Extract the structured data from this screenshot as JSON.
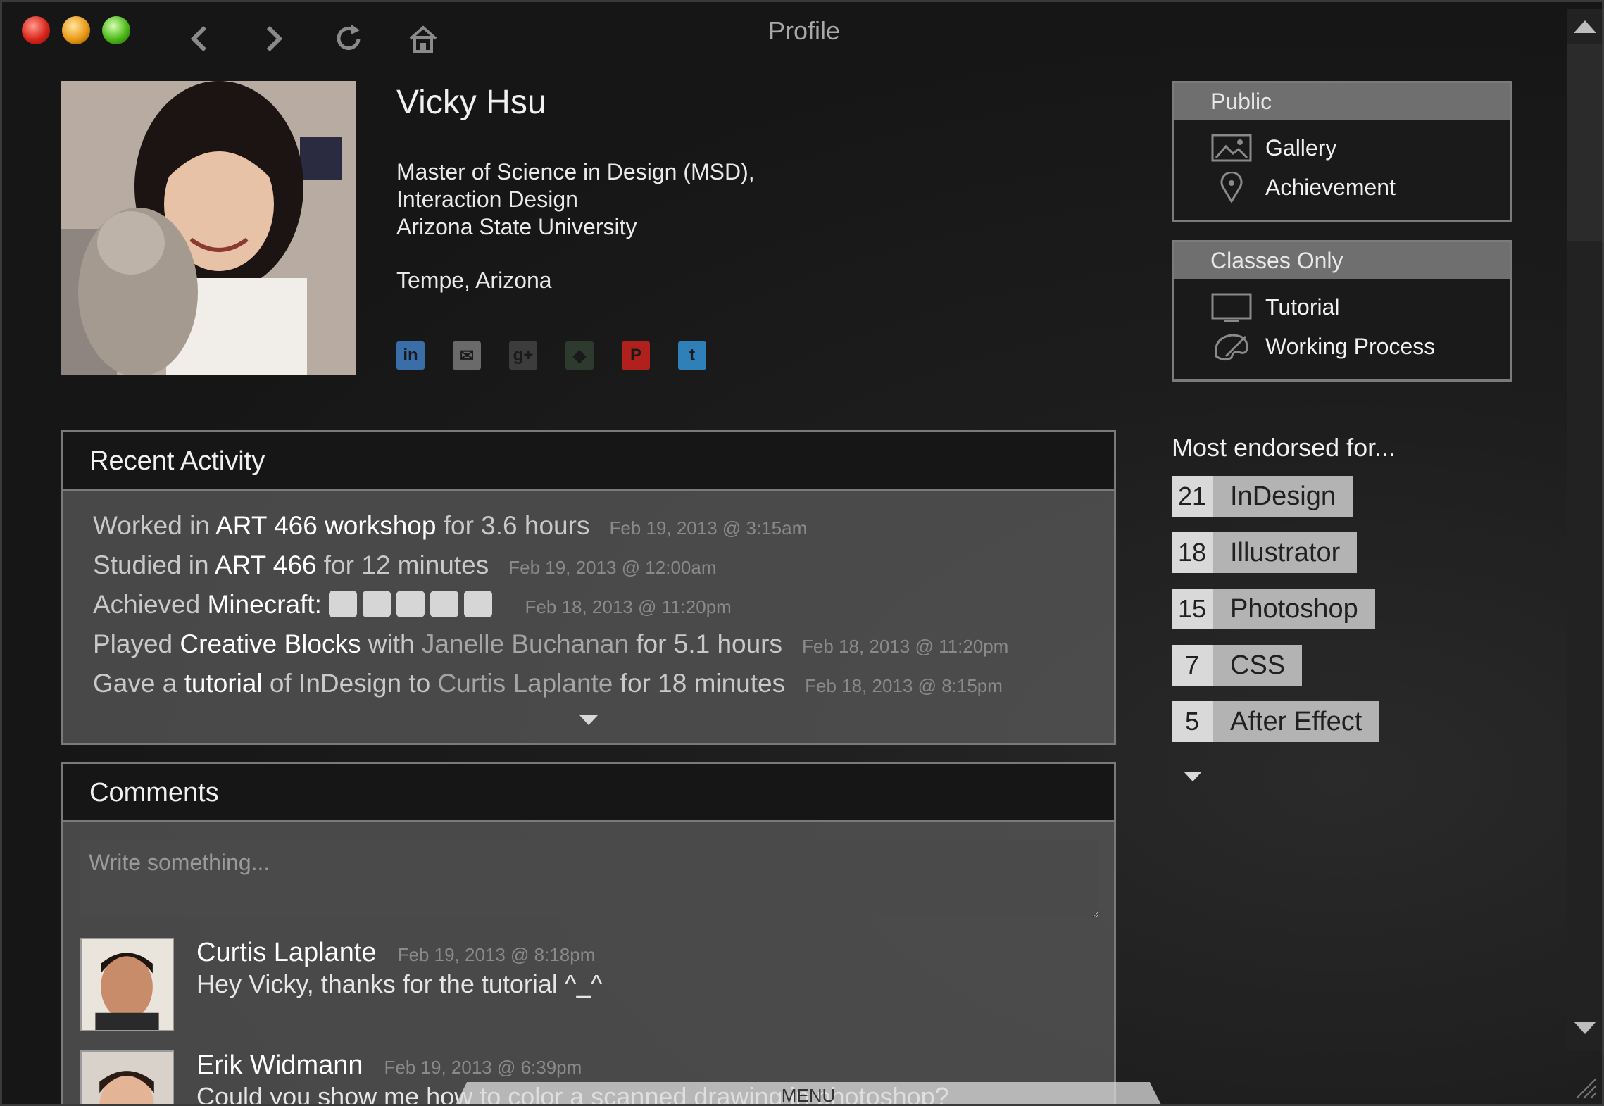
{
  "window": {
    "title": "Profile"
  },
  "toolbar": {
    "back_icon": "chevron-left-icon",
    "forward_icon": "chevron-right-icon",
    "reload_icon": "reload-icon",
    "home_icon": "home-icon"
  },
  "profile": {
    "name": "Vicky Hsu",
    "bio": [
      "Master of Science in Design (MSD),",
      "Interaction Design",
      "Arizona State University"
    ],
    "location": "Tempe, Arizona",
    "socials": [
      {
        "icon": "linkedin-icon",
        "glyph": "in",
        "color": "#3a6ea8"
      },
      {
        "icon": "email-icon",
        "glyph": "✉",
        "color": "#6a6a6a"
      },
      {
        "icon": "google-plus-icon",
        "glyph": "g+",
        "color": "#3c3c3c"
      },
      {
        "icon": "slideshare-icon",
        "glyph": "◆",
        "color": "#2e3a2e"
      },
      {
        "icon": "pinterest-icon",
        "glyph": "P",
        "color": "#b0211d"
      },
      {
        "icon": "twitter-icon",
        "glyph": "t",
        "color": "#2f7fb8"
      }
    ]
  },
  "sidebar": {
    "public": {
      "title": "Public",
      "items": [
        {
          "label": "Gallery",
          "icon": "image-icon"
        },
        {
          "label": "Achievement",
          "icon": "location-pin-icon"
        }
      ]
    },
    "classes": {
      "title": "Classes Only",
      "items": [
        {
          "label": "Tutorial",
          "icon": "monitor-icon"
        },
        {
          "label": "Working Process",
          "icon": "palette-icon"
        }
      ]
    },
    "endorsed_title": "Most endorsed for...",
    "endorsements": [
      {
        "count": "21",
        "skill": "InDesign"
      },
      {
        "count": "18",
        "skill": "Illustrator"
      },
      {
        "count": "15",
        "skill": "Photoshop"
      },
      {
        "count": "7",
        "skill": "CSS"
      },
      {
        "count": "5",
        "skill": "After Effect"
      }
    ]
  },
  "activity": {
    "title": "Recent Activity",
    "items": [
      {
        "pre": "Worked in ",
        "hl": "ART 466 workshop",
        "mid": " for 3.6 hours",
        "ts": "Feb 19, 2013 @ 3:15am"
      },
      {
        "pre": "Studied in ",
        "hl": "ART 466",
        "mid": " for 12 minutes",
        "ts": "Feb 19, 2013 @ 12:00am"
      },
      {
        "pre": "Achieved ",
        "hl": "Minecraft:",
        "mid": "",
        "ts": "Feb 18, 2013 @ 11:20pm"
      },
      {
        "pre": "Played ",
        "hl": "Creative Blocks",
        "mid": " with ",
        "person": "Janelle Buchanan",
        "post": " for 5.1 hours",
        "ts": "Feb 18, 2013 @ 11:20pm"
      },
      {
        "pre": "Gave a ",
        "hl": "tutorial",
        "mid": " of InDesign to ",
        "person": "Curtis Laplante",
        "post": " for 18 minutes",
        "ts": "Feb 18, 2013 @ 8:15pm"
      }
    ],
    "badges": [
      "checkmark-badge-icon",
      "puzzle-badge-icon",
      "chat-badge-icon",
      "anchor-badge-icon",
      "face-badge-icon"
    ]
  },
  "comments": {
    "title": "Comments",
    "placeholder": "Write something...",
    "items": [
      {
        "author": "Curtis Laplante",
        "ts": "Feb 19, 2013 @ 8:18pm",
        "text": "Hey Vicky, thanks for the tutorial ^_^"
      },
      {
        "author": "Erik Widmann",
        "ts": "Feb 19, 2013 @ 6:39pm",
        "text": "Could you show me how to color a scanned drawing in photoshop?"
      }
    ]
  },
  "menu_label": "MENU"
}
